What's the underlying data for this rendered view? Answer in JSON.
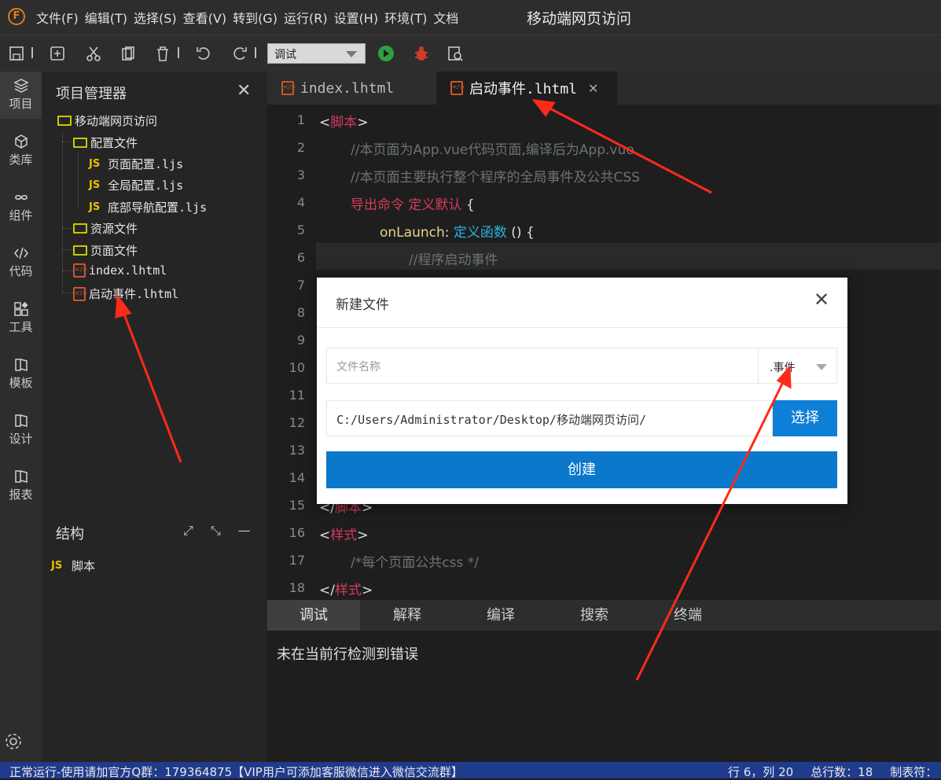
{
  "app": {
    "logo_letter": "F",
    "window_title": "移动端网页访问"
  },
  "menu": {
    "items": [
      "文件(F)",
      "编辑(T)",
      "选择(S)",
      "查看(V)",
      "转到(G)",
      "运行(R)",
      "设置(H)",
      "环境(T)",
      "文档"
    ]
  },
  "toolbar": {
    "run_mode": "调试"
  },
  "activity": {
    "items": [
      "项目",
      "类库",
      "组件",
      "代码",
      "工具",
      "模板",
      "设计",
      "报表"
    ]
  },
  "project": {
    "title": "项目管理器",
    "root": "移动端网页访问",
    "config_folder": "配置文件",
    "config_files": [
      "页面配置.ljs",
      "全局配置.ljs",
      "底部导航配置.ljs"
    ],
    "js_badge": "JS",
    "resource_folder": "资源文件",
    "page_folder": "页面文件",
    "files": [
      "index.lhtml",
      "启动事件.lhtml"
    ]
  },
  "structure": {
    "title": "结构",
    "item": "脚本"
  },
  "tabs": [
    "index.lhtml",
    "启动事件.lhtml"
  ],
  "editor": {
    "line_numbers": [
      "1",
      "2",
      "3",
      "4",
      "5",
      "6",
      "7",
      "8",
      "9",
      "10",
      "11",
      "12",
      "13",
      "14",
      "15",
      "16",
      "17",
      "18"
    ],
    "l1_tag": "脚本",
    "l2": "//本页面为App.vue代码页面,编译后为App.vue",
    "l3": "//本页面主要执行整个程序的全局事件及公共CSS",
    "l4_a": "导出命令",
    "l4_b": "定义默认",
    "l4_c": "{",
    "l5_a": "onLaunch",
    "l5_b": ":",
    "l5_c": "定义函数",
    "l5_d": "() {",
    "l6": "//程序启动事件",
    "l15_tag": "脚本",
    "l16_tag": "样式",
    "l17": "/*每个页面公共css */",
    "l18_tag": "样式",
    "lt": "<",
    "gt": ">",
    "close_lt": "</"
  },
  "panel": {
    "tabs": [
      "调试",
      "解释",
      "编译",
      "搜索",
      "终端"
    ],
    "message": "未在当前行检测到错误"
  },
  "status": {
    "left": "正常运行-使用请加官方Q群：179364875【VIP用户可添加客服微信进入微信交流群】",
    "line": "行 6，列 20",
    "total": "总行数：18",
    "tab": "制表符："
  },
  "dialog": {
    "title": "新建文件",
    "name_placeholder": "文件名称",
    "type": ".事件",
    "path": "C:/Users/Administrator/Desktop/移动端网页访问/",
    "choose": "选择",
    "create": "创建"
  },
  "colors": {
    "accent": "#0b78cc",
    "statusbar": "#1f3b8c",
    "keyword_red": "#d63a5c",
    "keyword_blue": "#2ab0e0",
    "annotation_arrow": "#ff2a1a"
  }
}
